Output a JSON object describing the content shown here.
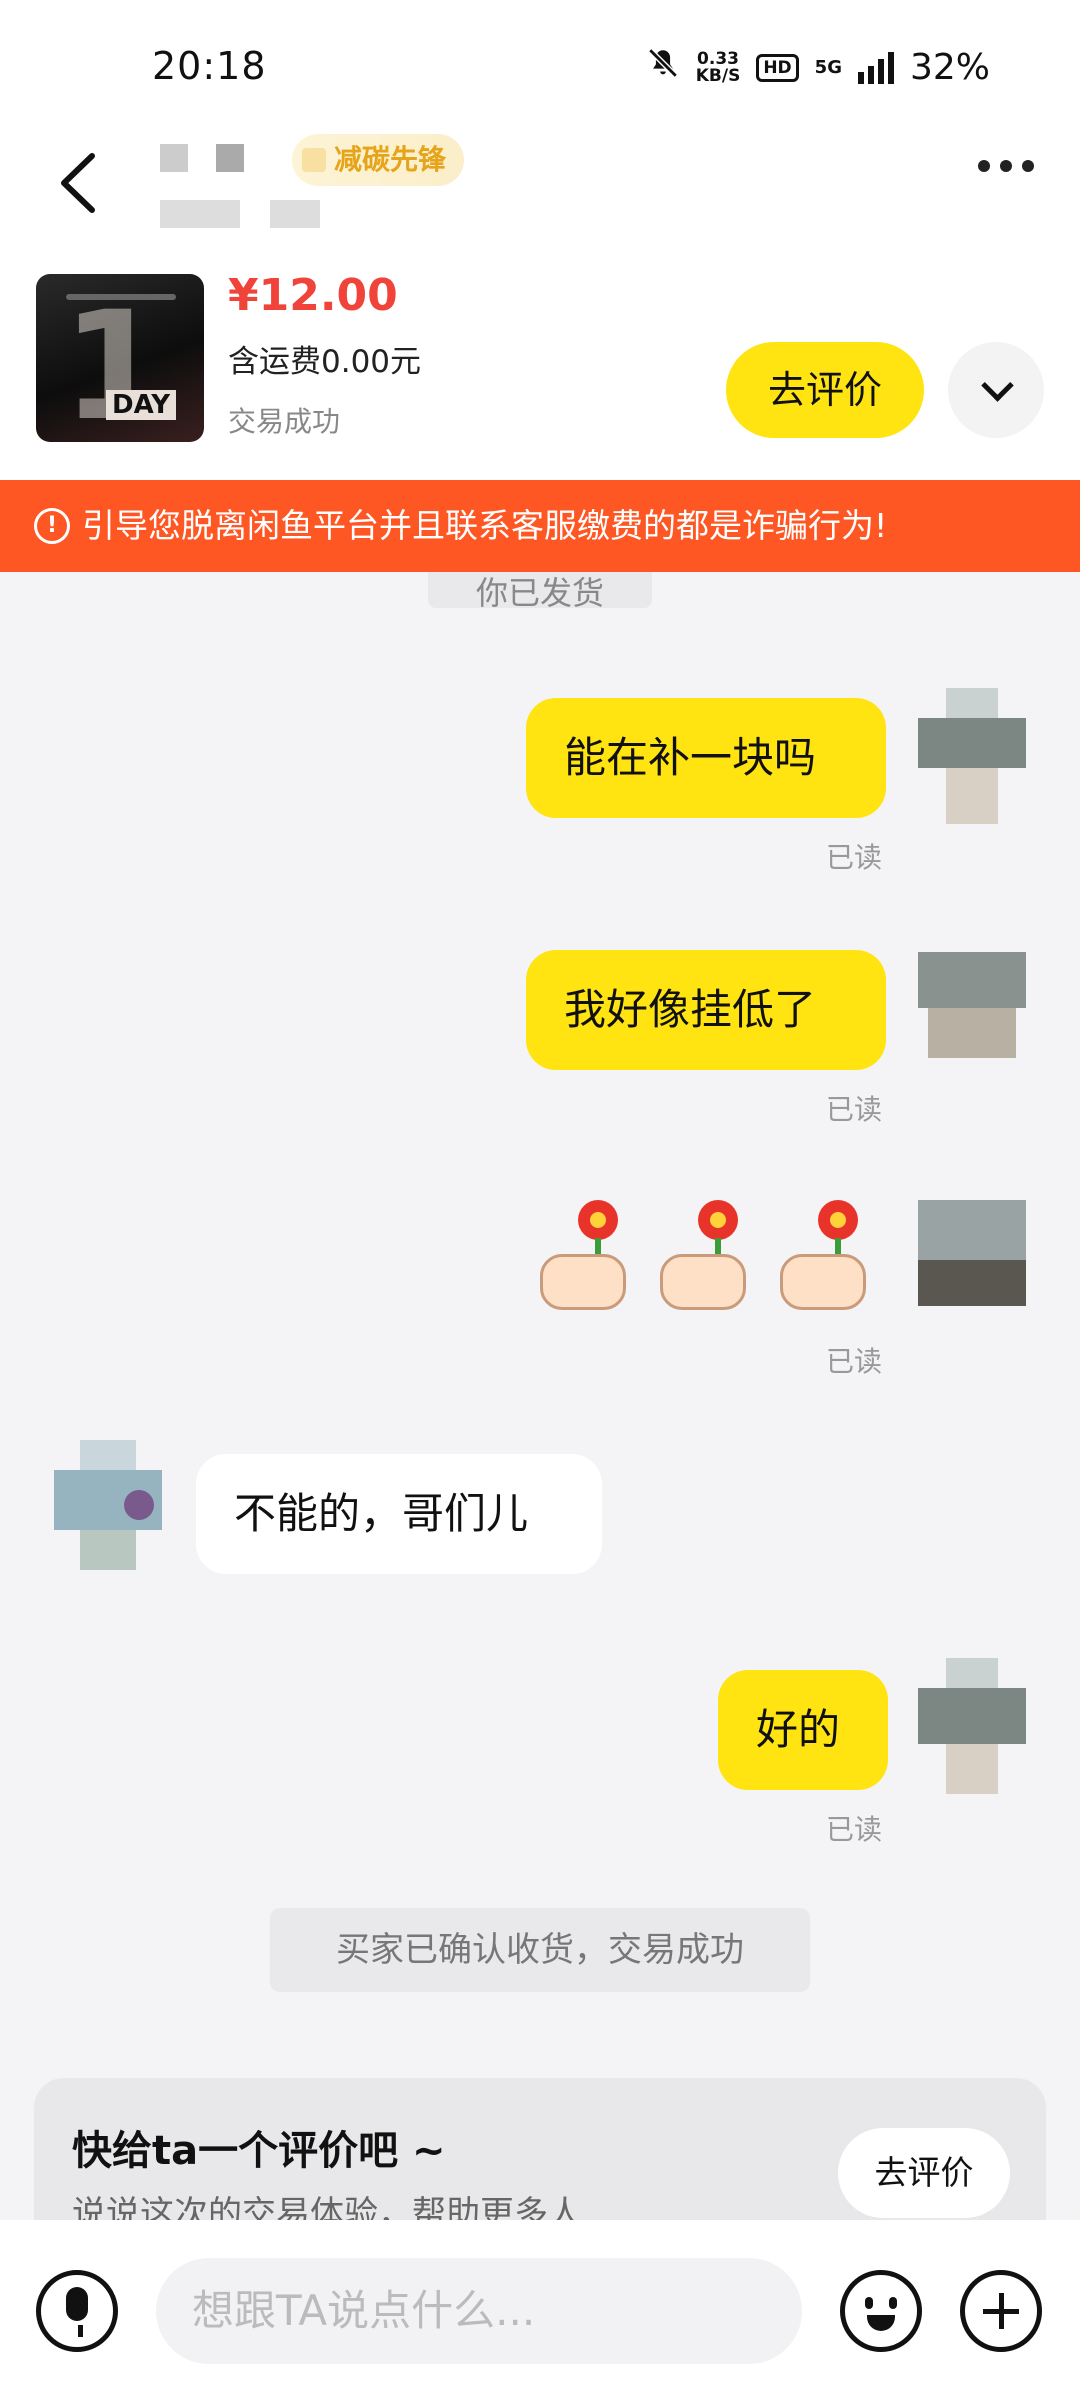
{
  "status_bar": {
    "time": "20:18",
    "net_speed": "0.33",
    "net_unit": "KB/S",
    "hd": "HD",
    "network": "5G",
    "battery": "32%"
  },
  "header": {
    "badge": "减碳先锋"
  },
  "product": {
    "price": "¥12.00",
    "shipping": "含运费0.00元",
    "status": "交易成功",
    "review_button": "去评价",
    "thumb_day": "DAY",
    "thumb_num": "1"
  },
  "warning": {
    "text": "引导您脱离闲鱼平台并且联系客服缴费的都是诈骗行为!"
  },
  "chat": {
    "system_top": "你已发货",
    "messages": [
      {
        "from": "me",
        "text": "能在补一块吗",
        "read": "已读"
      },
      {
        "from": "me",
        "text": "我好像挂低了",
        "read": "已读"
      },
      {
        "from": "me",
        "type": "emoji",
        "read": "已读"
      },
      {
        "from": "other",
        "text": "不能的，哥们儿"
      },
      {
        "from": "me",
        "text": "好的",
        "read": "已读"
      }
    ],
    "system_bottom": "买家已确认收货，交易成功"
  },
  "review_card": {
    "title": "快给ta一个评价吧 ~",
    "subtitle": "说说这次的交易体验，帮助更多人",
    "button": "去评价"
  },
  "input": {
    "placeholder": "想跟TA说点什么..."
  }
}
